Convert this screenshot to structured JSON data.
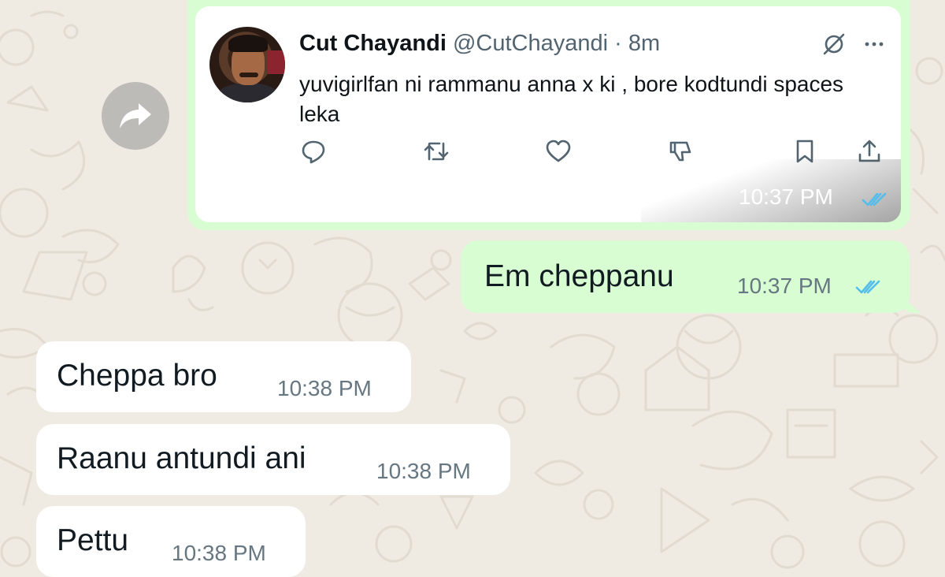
{
  "colors": {
    "chat_background": "#efeae2",
    "outgoing_bubble": "#d9fdd3",
    "incoming_bubble": "#ffffff",
    "read_receipt_blue": "#53bdeb",
    "timestamp_gray": "#667781"
  },
  "forward_button": {
    "icon": "forward-arrow-icon"
  },
  "quoted_tweet": {
    "author_name": "Cut Chayandi",
    "handle_time": "@CutChayandi · 8m",
    "text": "yuvigirlfan ni rammanu anna x ki , bore kodtundi spaces leka",
    "header_icons": [
      "grok-icon",
      "more-icon"
    ],
    "actions": [
      "reply-icon",
      "retweet-icon",
      "like-icon",
      "downvote-icon",
      "bookmark-icon",
      "share-icon"
    ],
    "time": "10:37 PM",
    "status": "read"
  },
  "messages": [
    {
      "direction": "outgoing",
      "text": "Em cheppanu",
      "time": "10:37 PM",
      "status": "read"
    },
    {
      "direction": "incoming",
      "text": "Cheppa bro",
      "time": "10:38 PM"
    },
    {
      "direction": "incoming",
      "text": "Raanu antundi ani",
      "time": "10:38 PM"
    },
    {
      "direction": "incoming",
      "text": "Pettu",
      "time": "10:38 PM"
    }
  ]
}
